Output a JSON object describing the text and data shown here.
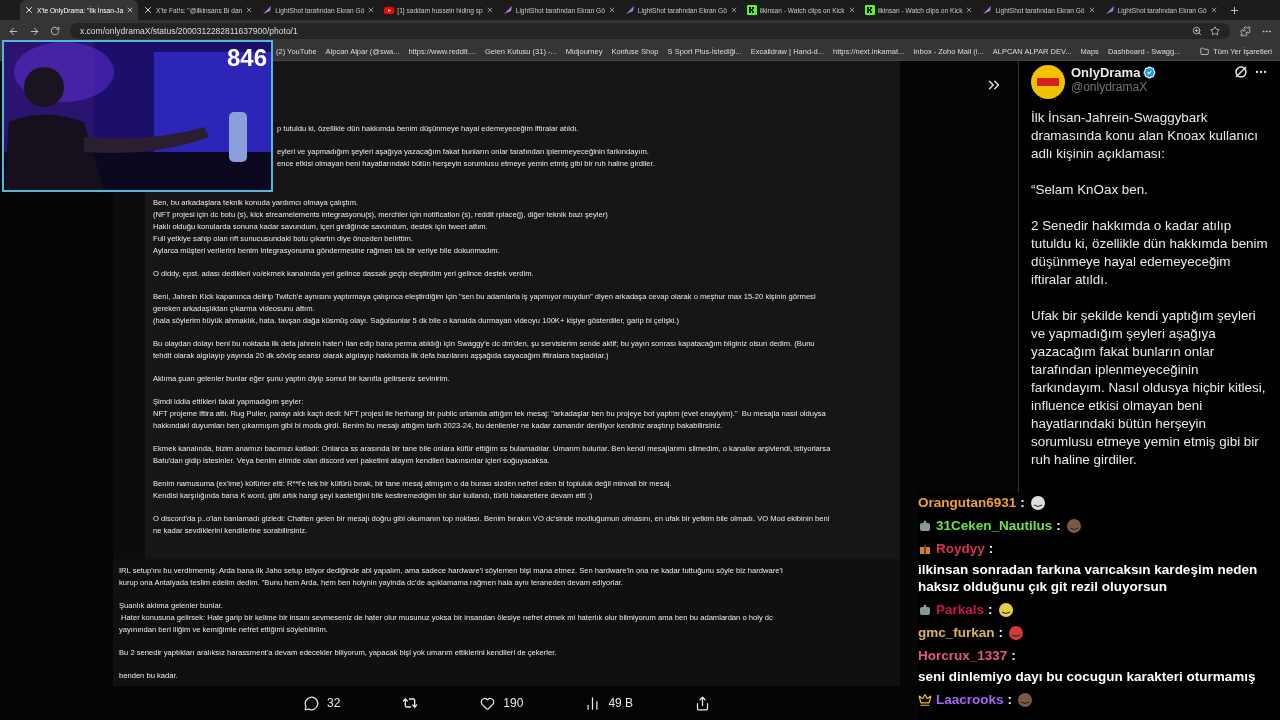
{
  "tabs": [
    {
      "kind": "x",
      "title": "X'te OnlyDrama: \"İlk İnsan-Ja",
      "selected": true
    },
    {
      "kind": "x",
      "title": "X'te Fat!s: \"@ilkinsans Bi dan",
      "selected": false
    },
    {
      "kind": "lightshot",
      "title": "LightShot tarafından Ekran Gö",
      "selected": false
    },
    {
      "kind": "youtube",
      "title": "[1] saddam hussein hiding sp",
      "selected": false
    },
    {
      "kind": "lightshot",
      "title": "LightShot tarafından Ekran Gö",
      "selected": false
    },
    {
      "kind": "lightshot",
      "title": "LightShot tarafından Ekran Gö",
      "selected": false
    },
    {
      "kind": "kick",
      "title": "ilkinsan - Watch clips on Kick",
      "selected": false
    },
    {
      "kind": "kick",
      "title": "ilkinsan - Watch clips on Kick",
      "selected": false
    },
    {
      "kind": "lightshot",
      "title": "LightShot tarafından Ekran Gö",
      "selected": false
    },
    {
      "kind": "lightshot",
      "title": "LightShot tarafından Ekran Gö",
      "selected": false
    }
  ],
  "address": "x.com/onlydramaX/status/2000312282811637900/photo/1",
  "bookmarks": [
    "(2) YouTube",
    "Alpcan Alpar (@swa...",
    "https://www.reddit....",
    "Gelen Kutusu (31) -...",
    "Midjourney",
    "Konfuse Shop",
    "S Sport Plus-İstediği...",
    "Excalidraw | Hand-d...",
    "https://next.inkamat...",
    "Inbox - Zoho Mail (i...",
    "ALPCAN ALPAR DEV...",
    "Maps",
    "Dashboard - Swagg..."
  ],
  "all_bookmarks": "Tüm Yer İşaretleri",
  "webcam": {
    "viewer_count": "846"
  },
  "document": [
    {
      "kind": "cut",
      "paragraphs": [
        [
          "p tutuldu ki, özellikle dün hakkımda benim düşünmeye hayal edemeyeceğim iftiralar atıldı."
        ],
        [
          "eyleri ve yapmadığım şeyleri aşağıya yazacağım fakat bunların onlar tarafından iplenmeyeceğinin farkındayım.",
          "ence etkisi olmayan beni hayatlarındaki bütün herşeyin sorumlusu etmeye yemin etmiş gibi bir ruh haline girdiler."
        ]
      ]
    },
    {
      "kind": "full",
      "paragraphs": [
        [
          "Ben, bu arkadaşlara teknik konuda yardımcı olmaya çalıştım.",
          "(NFT projesi için dc botu (s), kick streamelements integrasyonu(s), merchler için notification (s), reddit rplace(j), diğer teknik bazı şeyler)",
          "Haklı olduğu konularda sonuna kadar savundum, içeri girdiğinde savundum, destek için tweet attım.",
          "Full yetkiye sahip olan nft sunucusundaki botu çıkartın diye önceden belirttim.",
          "Aylarca müşteri verilerini benim integrasyonuma göndermesine rağmen tek bir veriye bile dokunmadım."
        ],
        [
          "O diddy, epst. adası dedikleri vo/ekmek kanalında yeri gelince dassak geçip eleştirdim yeri gelince destek verdim."
        ],
        [
          "Beni, Jahrein Kick kapanınca delirip Twitch'e aynısını yaptırmaya çalışınca eleştirdiğim için \"sen bu adamlarla iş yapmıyor muydun\" diyen arkadaşa cevap olarak o meşhur max 15-20 kişinin görmesi",
          "gereken arkadaşlıktan çıkarma videosunu attım.",
          "(hala söylerim büyük ahmaklık, hata. tavşan dağa küsmüş olayı. Sağolsunlar 5 dk bile o kanalda durmayan videoyu 100K+ kişiye gösterdiler, garip bi çelişki.)"
        ],
        [
          "Bu olaydan dolayı beni bu noktada ilk defa jahrein hater'ı ilan edip bana perma atıldığı için Swaggy'e dc dm'den, şu servislerim sende aktif; bu yayın sonrası kapatacağım bilginiz olsun dedim. (Bunu",
          "tehdit olarak algılayıp yayında 20 dk sövüş seansı olarak algılayıp hakkımda ilk defa bazılarını aşşağıda sayacağım iftiralara başladılar.)"
        ],
        [
          "Aklıma şuan gelenler bunlar eğer şunu yaptın diyip somut bir kanıtla gelirseniz sevinirim."
        ],
        [
          "Şimdi iddia ettikleri fakat yapmadığım şeyler:",
          "NFT projeme iftira attı. Rug Puller, parayı aldı kaçtı dedi: NFT projesi ile herhangi bir public ortamda attığım tek mesaj: \"arkadaşlar ben bu projeye bot yaptım (evet enayiyim).\"  Bu mesajla nasıl olduysa",
          "hakkındaki duyumları ben çıkarmışım gibi bi moda girdi. Benim bu mesajı attığım tarih 2023-24, bu denilenler ne kadar zamandır deniliyor kendiniz araştırıp bakabilirsiniz."
        ],
        [
          "Ekmek kanalında, bizim anamızı bacımızı katladı: Onlarca ss arasında bir tane bile onlara küfür ettiğim ss bulamadılar. Umarım bulurlar. Ben kendi mesajlarımı silmedim, o kanallar arşivlendi, istiyorlarsa",
          "Batu'dan gidip istesinler. Veya benim elimde olan discord veri paketimi atayım kendileri bakınsınlar içleri soğuyacaksa."
        ],
        [
          "Benim namusuma (ex'ime) küfürler etti: R**l'e tek bir küfürü bırak, bir tane mesaj atmışım o da burası sizden nefret eden bi topluluk değil minvali bir mesaj.",
          "Kendisi karşılığında bana K word, gibi artık hangi şeyi kastetiğini bile kestiremediğim bir slur kullandı, türlü hakaretlere devam etti :)"
        ],
        [
          "O discord'da p..o'lan banlamadı gizledi: Chatten gelen bir mesajı doğru gibi okumanın top noktası. Benim bırakın VO dc'sinde modluğumun olmasını, en ufak bir yetkim bile olmadı. VO Mod ekibinin beni",
          "ne kadar sevdiklerini kendilerine sorabilirsiniz."
        ]
      ]
    },
    {
      "kind": "wide",
      "paragraphs": [
        [
          "IRL setup'ını bu verdirmemiş: Arda bana ilk Jaho setup istiyor dediğinde abi yapalım, ama sadece hardware'i söylemen bişi mana etmez. Sen hardware'in ona ne kadar tuttuğunu söyle biz hardware'i",
          "kurup ona Antalyada teslim edelim dedim. \"Bunu hem Arda, hem ben holynin yayinda dc'de açıklamama rağmen hala aynı teraneden devam ediyorlar."
        ],
        [
          "Şuanlık aklıma gelenler bunlar.",
          " Hater konusuna gelirsek: Hate garip bir kelime bir insanı sevmeseniz de hater olur musunuz yoksa bir insandan ölesiye nefret etmek mi haterlık olur bilmiyorum ama ben bu adamlardan o holy dc",
          "yayınından beri iliğim ve kemiğimle nefret ettiğimi söylebiliriim."
        ],
        [
          "Bu 2 senedir yaptıkları aralıksız harassment'a devam edecekler biliyorum, yapacak bişi yok umarım ettiklerini kendileri de çekerler."
        ],
        [
          "benden bu kadar."
        ]
      ]
    }
  ],
  "actions": {
    "replies": "32",
    "likes": "190",
    "views": "49 B"
  },
  "post": {
    "name": "OnlyDrama",
    "handle": "@onlydramaX",
    "paragraphs": [
      "İlk İnsan-Jahrein-Swaggybark dramasında konu alan Knoax kullanıcı adlı kişinin açıklaması:",
      "“Selam KnOax ben.",
      "2 Senedir hakkımda o kadar atılıp tutuldu ki, özellikle dün hakkımda benim düşünmeye hayal edemeyeceğim iftiralar atıldı.",
      "Ufak bir şekilde kendi yaptığım şeyleri ve yapmadığım şeyleri aşağıya yazacağım fakat bunların onlar tarafından iplenmeyeceğinin farkındayım. Nasıl oldusya hiçbir kitlesi, influence etkisi olmayan beni hayatlarındaki bütün herşeyin sorumlusu etmeye yemin etmiş gibi bir ruh haline girdiler."
    ]
  },
  "chat": [
    {
      "user": "Orangutan6931",
      "color": "#f0a232",
      "separator": ":",
      "kind": "emote"
    },
    {
      "user": "31Ceken_Nautilus",
      "color": "#6ee04a",
      "badges": [
        {
          "kind": "bot"
        }
      ],
      "separator": ":",
      "kind": "emote"
    },
    {
      "user": "Roydyy",
      "color": "#d63350",
      "badges": [
        {
          "kind": "gift"
        }
      ],
      "separator": ":",
      "kind": "text",
      "text": "ilkinsan sonradan farkına varıcaksın kardeşim neden haksız olduğunu çık git rezil oluyorsun"
    },
    {
      "user": "Parkals",
      "color": "#c8194a",
      "badges": [
        {
          "kind": "bot"
        }
      ],
      "separator": ":",
      "kind": "emote"
    },
    {
      "user": "gmc_furkan",
      "color": "#d8b45a",
      "separator": ":",
      "kind": "emote"
    },
    {
      "user": "Horcrux_1337",
      "color": "#e2568e",
      "separator": ":",
      "kind": "text",
      "text": "seni dinlemiyo dayı bu cocugun karakteri oturmamış"
    },
    {
      "user": "Laacrooks",
      "color": "#a764f2",
      "badges": [
        {
          "kind": "crown"
        }
      ],
      "separator": ":",
      "kind": "emote"
    }
  ]
}
